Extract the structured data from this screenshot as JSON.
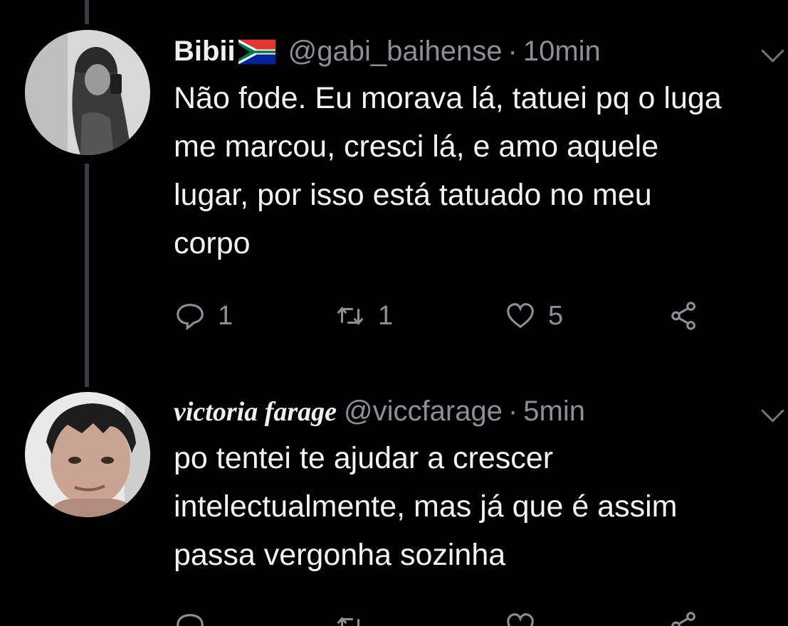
{
  "tweets": [
    {
      "display_name": "Bibii",
      "flag_icon": "south-africa-flag-icon",
      "handle": "@gabi_baihense",
      "separator": "·",
      "time": "10min",
      "text": "Não fode. Eu morava lá, tatuei pq o luga\nme marcou, cresci lá, e amo aquele\nlugar, por isso está tatuado no meu\ncorpo",
      "replies": "1",
      "retweets": "1",
      "likes": "5"
    },
    {
      "display_name": "victoria farage",
      "handle": "@viccfarage",
      "separator": "·",
      "time": "5min",
      "text": "po tentei te ajudar a crescer\nintelectualmente, mas já que é assim\npassa vergonha sozinha"
    }
  ],
  "colors": {
    "background": "#000000",
    "text": "#f2f2f2",
    "muted": "#8b9096",
    "thread_line": "#3a3d40"
  },
  "icons": [
    "reply-icon",
    "retweet-icon",
    "like-icon",
    "share-icon",
    "chevron-down-icon"
  ]
}
